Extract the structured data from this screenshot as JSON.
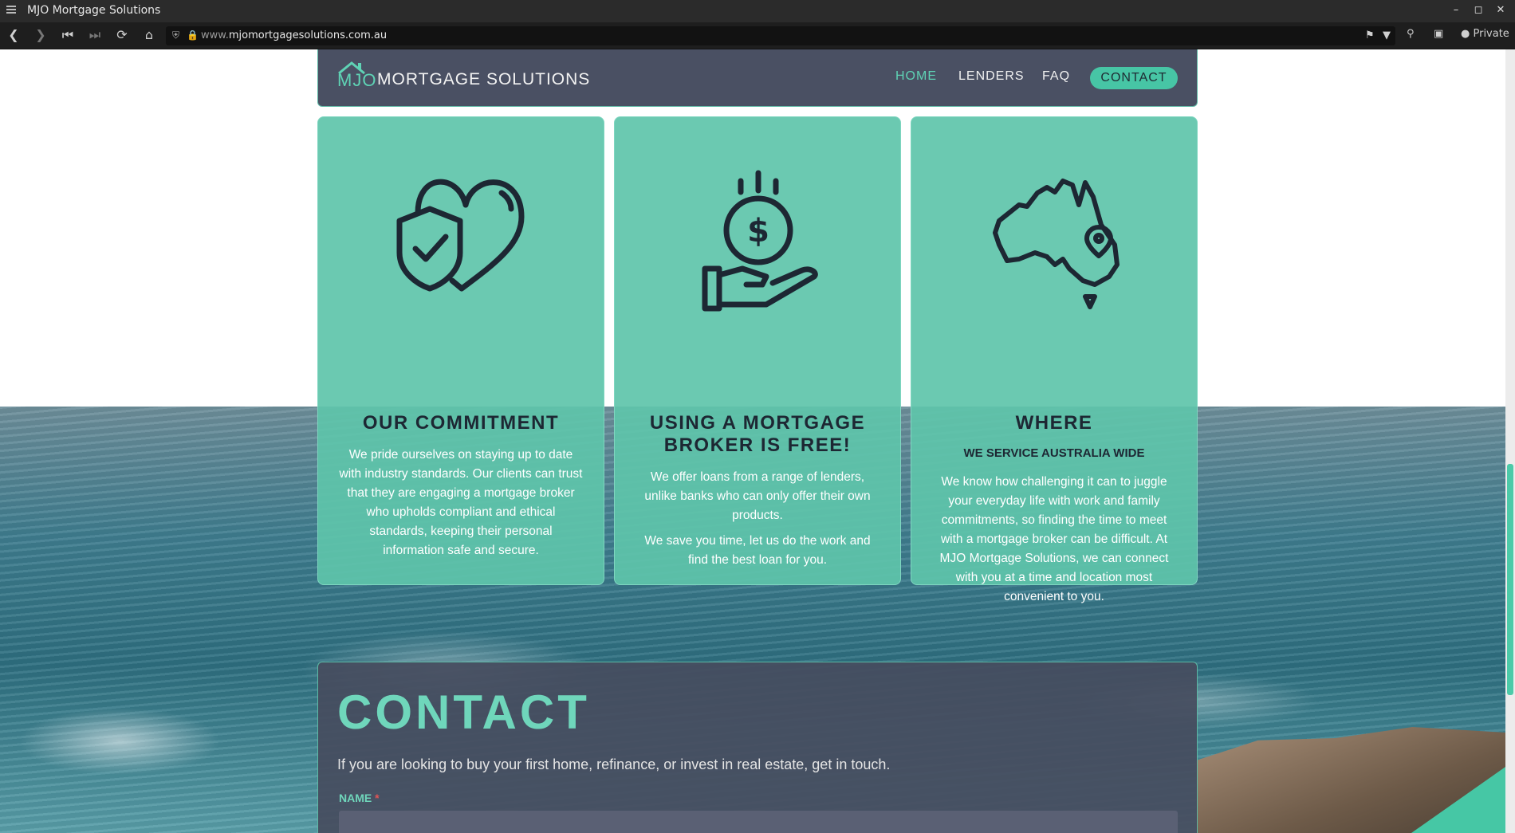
{
  "browser": {
    "window_title": "MJO Mortgage Solutions",
    "url_prefix": "www.",
    "url_domain": "mjomortgagesolutions.com.au",
    "private_label": "Private"
  },
  "header": {
    "logo_mjo": "MJO",
    "logo_text": "MORTGAGE SOLUTIONS",
    "nav": {
      "home": "HOME",
      "lenders": "LENDERS",
      "faq": "FAQ",
      "contact": "CONTACT"
    }
  },
  "cards": [
    {
      "title": "OUR COMMITMENT",
      "body": "We pride ourselves on staying up to date with industry standards. Our clients can trust that they are engaging a mortgage broker who upholds compliant and ethical standards, keeping their personal information safe and secure."
    },
    {
      "title": "USING A MORTGAGE BROKER IS FREE!",
      "body": "We offer loans from a range of lenders, unlike banks who can only offer their own products.",
      "body2": "We save you time, let us do the work and find the best loan for you."
    },
    {
      "title": "WHERE",
      "subtitle": "WE SERVICE AUSTRALIA WIDE",
      "body": "We know how challenging it can to juggle your everyday life with work and family commitments, so finding the time to meet with a mortgage broker can be difficult. At MJO Mortgage Solutions, we can connect with you at a time and location most convenient to you."
    }
  ],
  "contact": {
    "heading": "CONTACT",
    "lead": "If you are looking to buy your first home, refinance, or invest in real estate, get in touch.",
    "name_label": "NAME",
    "required_mark": "*"
  },
  "colors": {
    "accent": "#47c5a5",
    "header_bg": "#4a5063",
    "card_bg": "#5ec4aa",
    "dark_text": "#1d2733"
  }
}
